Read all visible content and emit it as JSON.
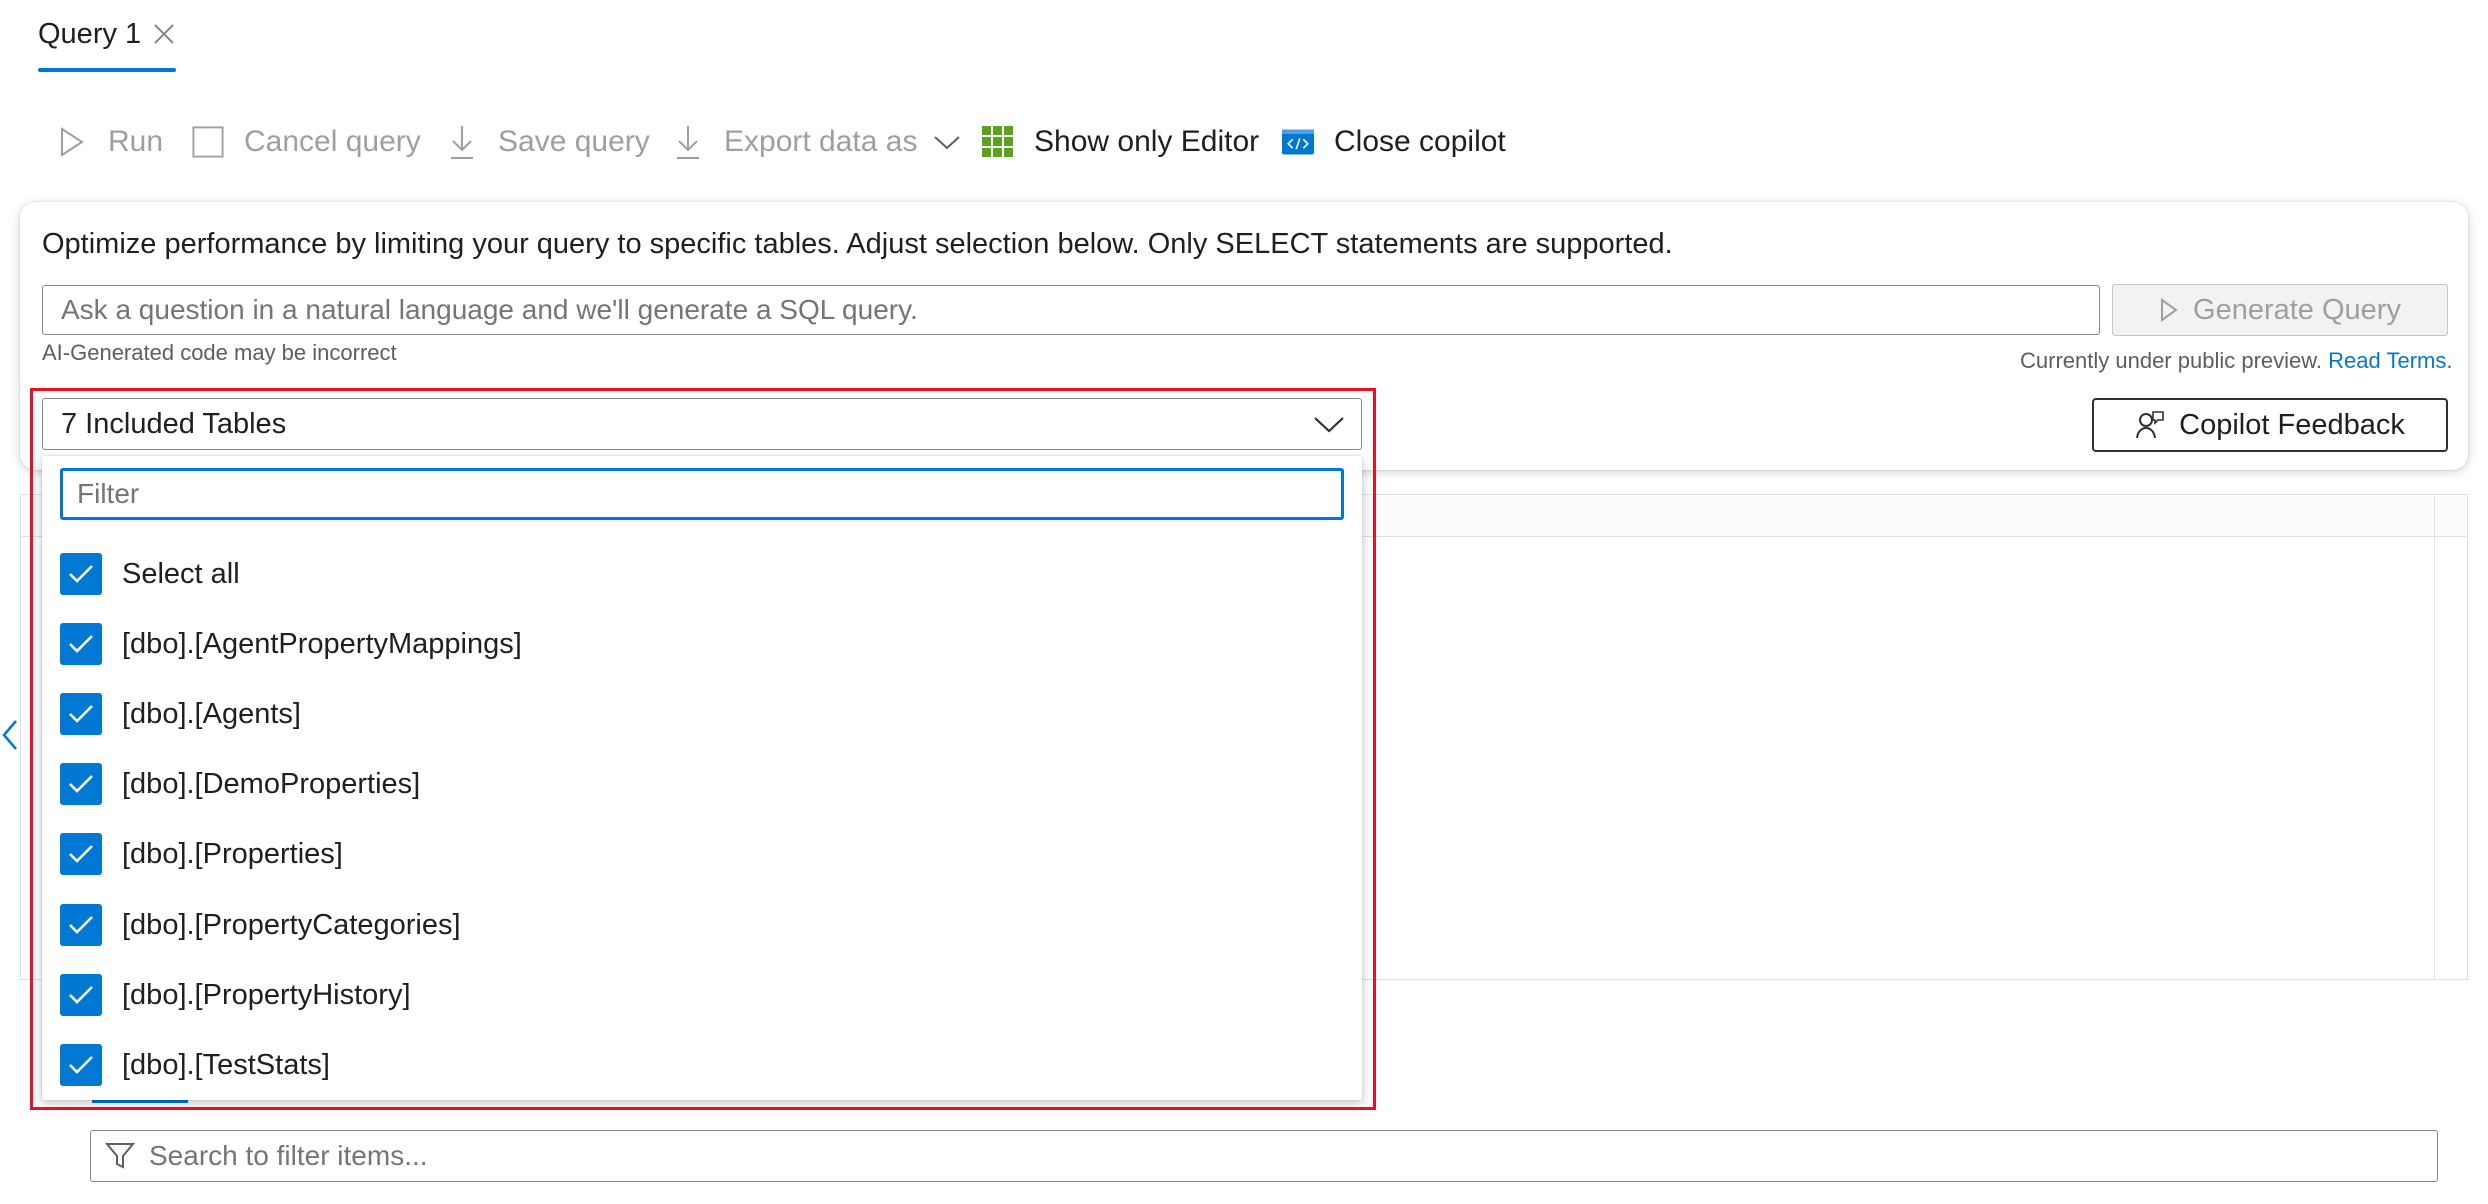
{
  "tab": {
    "label": "Query 1"
  },
  "toolbar": {
    "run": "Run",
    "cancel": "Cancel query",
    "save": "Save query",
    "export": "Export data as",
    "show_editor": "Show only Editor",
    "close_copilot": "Close copilot"
  },
  "copilot": {
    "info": "Optimize performance by limiting your query to specific tables. Adjust selection below. Only SELECT statements are supported.",
    "placeholder": "Ask a question in a natural language and we'll generate a SQL query.",
    "generate_label": "Generate Query",
    "ai_note": "AI-Generated code may be incorrect",
    "preview_note": "Currently under public preview.",
    "read_terms": "Read Terms.",
    "feedback_label": "Copilot Feedback"
  },
  "tables_dropdown": {
    "selected_label": "7 Included Tables",
    "filter_placeholder": "Filter",
    "options": [
      {
        "label": "Select all",
        "checked": true
      },
      {
        "label": "[dbo].[AgentPropertyMappings]",
        "checked": true
      },
      {
        "label": "[dbo].[Agents]",
        "checked": true
      },
      {
        "label": "[dbo].[DemoProperties]",
        "checked": true
      },
      {
        "label": "[dbo].[Properties]",
        "checked": true
      },
      {
        "label": "[dbo].[PropertyCategories]",
        "checked": true
      },
      {
        "label": "[dbo].[PropertyHistory]",
        "checked": true
      },
      {
        "label": "[dbo].[TestStats]",
        "checked": true
      }
    ]
  },
  "bottom_search": {
    "placeholder": "Search to filter items..."
  },
  "colors": {
    "accent": "#0078d4",
    "highlight": "#e81123",
    "editor_icon": "#5ba31d"
  }
}
